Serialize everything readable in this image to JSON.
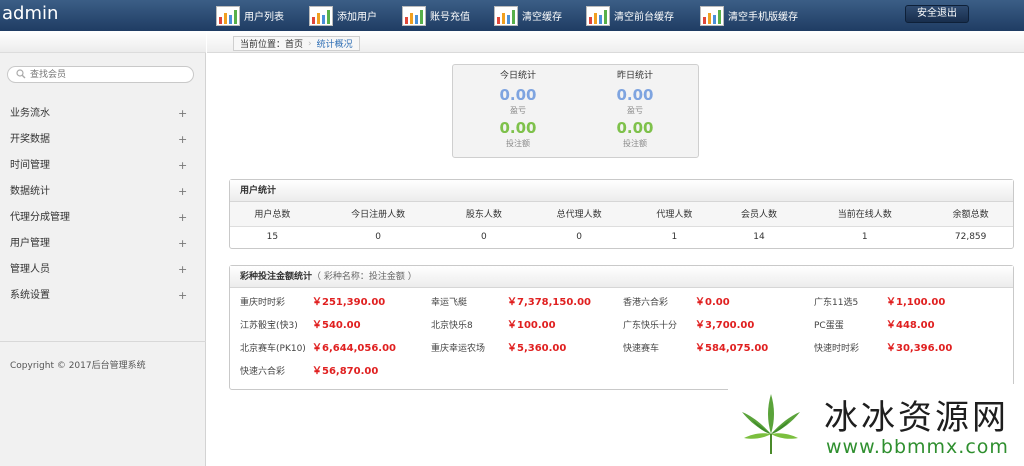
{
  "app": {
    "title": "admin"
  },
  "topnav": [
    {
      "label": "用户列表",
      "icon": "bar-chart-icon"
    },
    {
      "label": "添加用户",
      "icon": "bar-chart-icon"
    },
    {
      "label": "账号充值",
      "icon": "bar-chart-icon"
    },
    {
      "label": "清空缓存",
      "icon": "bar-chart-icon"
    },
    {
      "label": "清空前台缓存",
      "icon": "bar-chart-icon"
    },
    {
      "label": "清空手机版缓存",
      "icon": "bar-chart-icon"
    }
  ],
  "logout_label": "安全退出",
  "sidebar": {
    "search_placeholder": "查找会员",
    "items": [
      {
        "label": "业务流水",
        "toggle": "+"
      },
      {
        "label": "开奖数据",
        "toggle": "+"
      },
      {
        "label": "时间管理",
        "toggle": "+"
      },
      {
        "label": "数据统计",
        "toggle": "+"
      },
      {
        "label": "代理分成管理",
        "toggle": "+"
      },
      {
        "label": "用户管理",
        "toggle": "+"
      },
      {
        "label": "管理人员",
        "toggle": "+"
      },
      {
        "label": "系统设置",
        "toggle": "+"
      }
    ],
    "copyright": "Copyright © 2017后台管理系统"
  },
  "breadcrumb": {
    "current": "当前位置：首页",
    "active": "统计概况"
  },
  "stats": {
    "today": {
      "title": "今日统计",
      "profit": "0.00",
      "profit_label": "盈亏",
      "bet": "0.00",
      "bet_label": "投注额"
    },
    "yesterday": {
      "title": "昨日统计",
      "profit": "0.00",
      "profit_label": "盈亏",
      "bet": "0.00",
      "bet_label": "投注额"
    }
  },
  "user_stats": {
    "title": "用户统计",
    "headers": [
      "用户总数",
      "今日注册人数",
      "股东人数",
      "总代理人数",
      "代理人数",
      "会员人数",
      "当前在线人数",
      "余额总数"
    ],
    "values": [
      "15",
      "0",
      "0",
      "0",
      "1",
      "14",
      "1",
      "72,859"
    ]
  },
  "lottery": {
    "title": "彩种投注金额统计",
    "subtitle": "（ 彩种名称：投注金额 ）",
    "items": [
      {
        "name": "重庆时时彩",
        "amount": "￥251,390.00"
      },
      {
        "name": "幸运飞艇",
        "amount": "￥7,378,150.00"
      },
      {
        "name": "香港六合彩",
        "amount": "￥0.00"
      },
      {
        "name": "广东11选5",
        "amount": "￥1,100.00"
      },
      {
        "name": "江苏骰宝(快3)",
        "amount": "￥540.00"
      },
      {
        "name": "北京快乐8",
        "amount": "￥100.00"
      },
      {
        "name": "广东快乐十分",
        "amount": "￥3,700.00"
      },
      {
        "name": "PC蛋蛋",
        "amount": "￥448.00"
      },
      {
        "name": "北京赛车(PK10)",
        "amount": "￥6,644,056.00"
      },
      {
        "name": "重庆幸运农场",
        "amount": "￥5,360.00"
      },
      {
        "name": "快速赛车",
        "amount": "￥584,075.00"
      },
      {
        "name": "快速时时彩",
        "amount": "￥30,396.00"
      },
      {
        "name": "快速六合彩",
        "amount": "￥56,870.00"
      }
    ]
  },
  "watermark": {
    "title": "冰冰资源网",
    "url": "www.bbmmx.com"
  }
}
